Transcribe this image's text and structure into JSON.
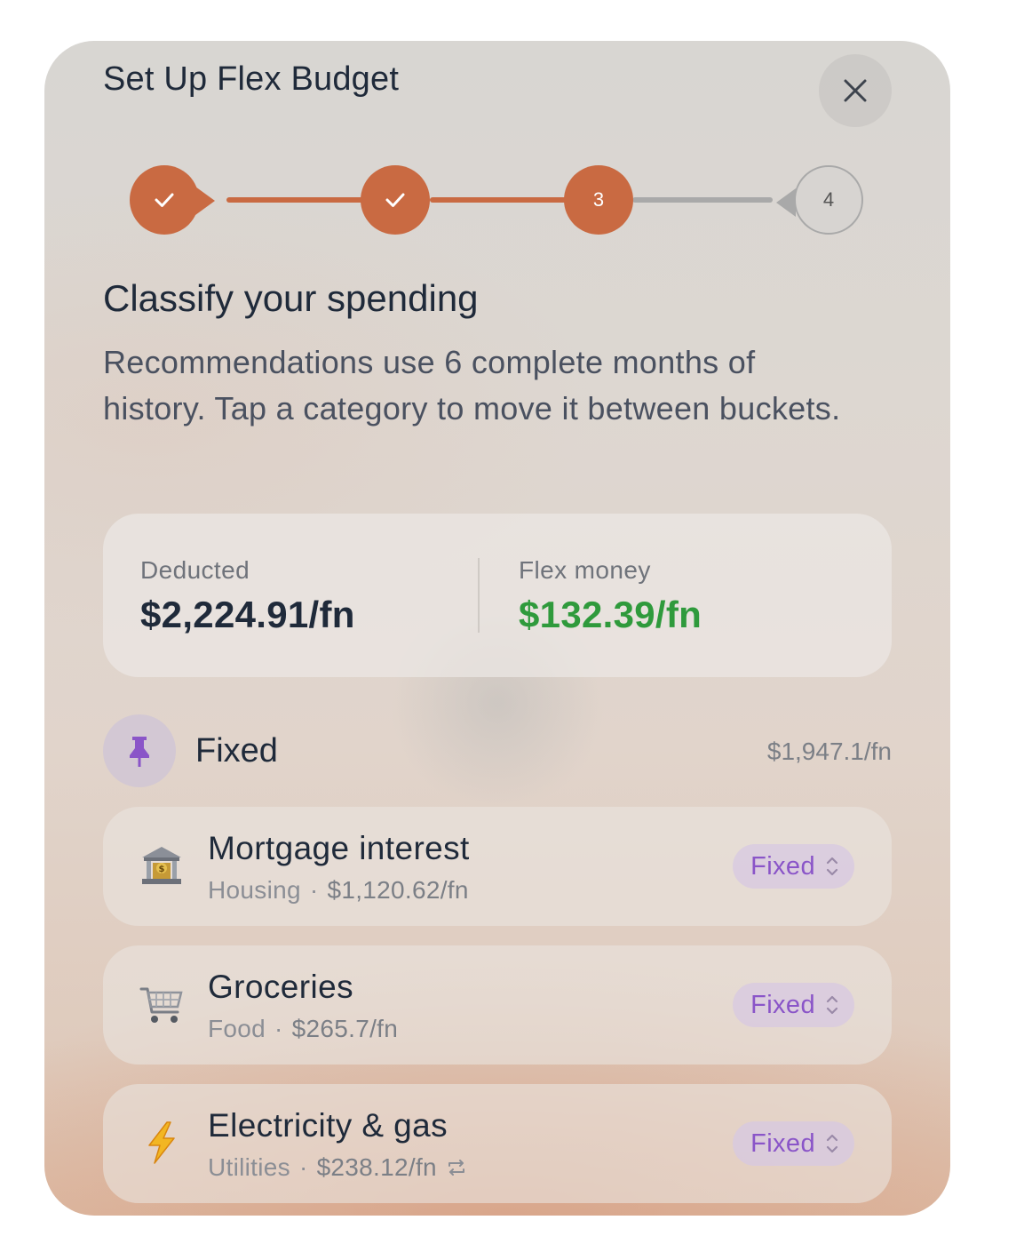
{
  "sheet": {
    "title": "Set Up Flex Budget",
    "close_icon": "close-icon"
  },
  "stepper": {
    "accent_color": "#c96a42",
    "steps": [
      {
        "label": "",
        "state": "done",
        "icon": "check-icon"
      },
      {
        "label": "",
        "state": "done",
        "icon": "check-icon"
      },
      {
        "label": "3",
        "state": "current"
      },
      {
        "label": "4",
        "state": "pending"
      }
    ]
  },
  "content": {
    "heading": "Classify your spending",
    "description": "Recommendations use 6 complete months of history. Tap a category to move it between buckets."
  },
  "summary": {
    "deducted_label": "Deducted",
    "deducted_value": "$2,224.91/fn",
    "flex_label": "Flex money",
    "flex_value": "$132.39/fn",
    "flex_color": "#2f9a3c"
  },
  "section": {
    "icon": "pin-icon",
    "title": "Fixed",
    "total": "$1,947.1/fn"
  },
  "rows": [
    {
      "icon": "bank-icon",
      "name": "Mortgage interest",
      "category": "Housing",
      "amount": "$1,120.62/fn",
      "recurring": false,
      "bucket": "Fixed"
    },
    {
      "icon": "shopping-cart-icon",
      "name": "Groceries",
      "category": "Food",
      "amount": "$265.7/fn",
      "recurring": false,
      "bucket": "Fixed"
    },
    {
      "icon": "lightning-icon",
      "name": "Electricity & gas",
      "category": "Utilities",
      "amount": "$238.12/fn",
      "recurring": true,
      "bucket": "Fixed"
    }
  ]
}
